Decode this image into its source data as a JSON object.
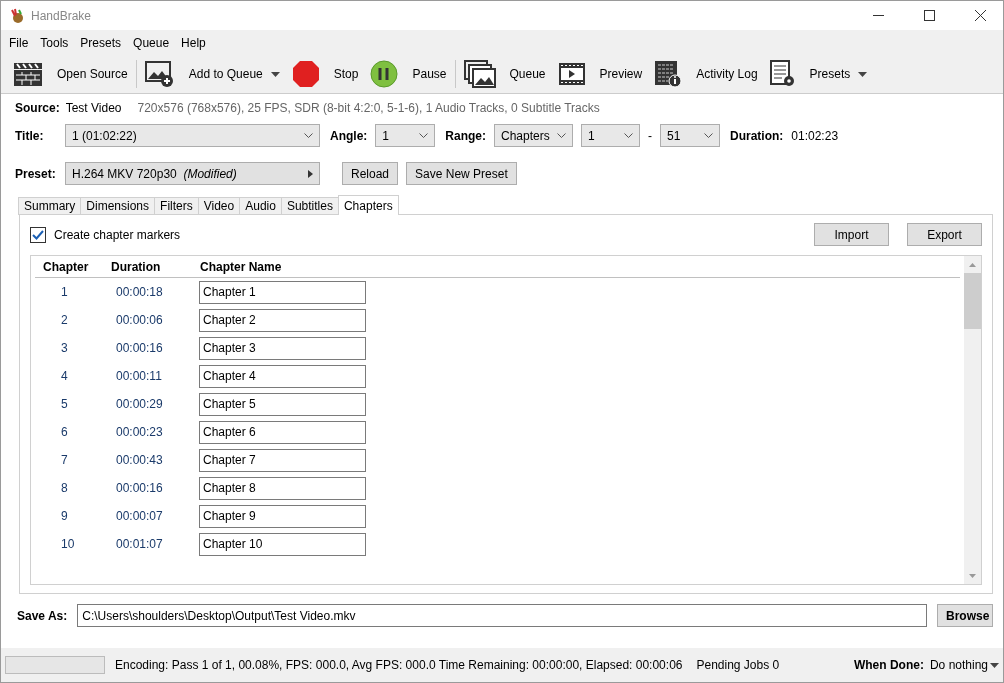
{
  "window": {
    "title": "HandBrake"
  },
  "menu": [
    "File",
    "Tools",
    "Presets",
    "Queue",
    "Help"
  ],
  "toolbar": [
    {
      "kind": "open",
      "label": "Open Source",
      "dropdown": false
    },
    {
      "kind": "add",
      "label": "Add to Queue",
      "dropdown": true
    },
    {
      "kind": "stop",
      "label": "Stop",
      "dropdown": false
    },
    {
      "kind": "pause",
      "label": "Pause",
      "dropdown": false
    },
    {
      "kind": "queue",
      "label": "Queue",
      "dropdown": false
    },
    {
      "kind": "preview",
      "label": "Preview",
      "dropdown": false
    },
    {
      "kind": "log",
      "label": "Activity Log",
      "dropdown": false
    },
    {
      "kind": "presets",
      "label": "Presets",
      "dropdown": true
    }
  ],
  "source": {
    "label": "Source:",
    "name": "Test Video",
    "info": "720x576 (768x576), 25 FPS, SDR (8-bit 4:2:0, 5-1-6), 1 Audio Tracks, 0 Subtitle Tracks"
  },
  "title_row": {
    "title_label": "Title:",
    "title_value": "1  (01:02:22)",
    "angle_label": "Angle:",
    "angle_value": "1",
    "range_label": "Range:",
    "range_mode": "Chapters",
    "range_start": "1",
    "range_dash": "-",
    "range_end": "51",
    "duration_label": "Duration:",
    "duration_value": "01:02:23"
  },
  "preset": {
    "label": "Preset:",
    "name": "H.264 MKV 720p30",
    "note": "(Modified)",
    "buttons": [
      "Reload",
      "Save New Preset"
    ]
  },
  "tabs": [
    {
      "label": "Summary",
      "selected": false
    },
    {
      "label": "Dimensions",
      "selected": false
    },
    {
      "label": "Filters",
      "selected": false
    },
    {
      "label": "Video",
      "selected": false
    },
    {
      "label": "Audio",
      "selected": false
    },
    {
      "label": "Subtitles",
      "selected": false
    },
    {
      "label": "Chapters",
      "selected": true
    }
  ],
  "chapters_panel": {
    "create_markers": {
      "label": "Create chapter markers",
      "checked": true
    },
    "buttons": [
      "Import",
      "Export"
    ],
    "columns": [
      "Chapter",
      "Duration",
      "Chapter Name"
    ],
    "rows": [
      {
        "chapter": "1",
        "duration": "00:00:18",
        "name": "Chapter 1"
      },
      {
        "chapter": "2",
        "duration": "00:00:06",
        "name": "Chapter 2"
      },
      {
        "chapter": "3",
        "duration": "00:00:16",
        "name": "Chapter 3"
      },
      {
        "chapter": "4",
        "duration": "00:00:11",
        "name": "Chapter 4"
      },
      {
        "chapter": "5",
        "duration": "00:00:29",
        "name": "Chapter 5"
      },
      {
        "chapter": "6",
        "duration": "00:00:23",
        "name": "Chapter 6"
      },
      {
        "chapter": "7",
        "duration": "00:00:43",
        "name": "Chapter 7"
      },
      {
        "chapter": "8",
        "duration": "00:00:16",
        "name": "Chapter 8"
      },
      {
        "chapter": "9",
        "duration": "00:00:07",
        "name": "Chapter 9"
      },
      {
        "chapter": "10",
        "duration": "00:01:07",
        "name": "Chapter 10"
      }
    ]
  },
  "save_as": {
    "label": "Save As:",
    "path": "C:\\Users\\shoulders\\Desktop\\Output\\Test Video.mkv",
    "button": "Browse"
  },
  "status_bar": {
    "progress": {
      "level": 0
    },
    "encoding": "Encoding: Pass 1 of 1,  00.08%, FPS: 000.0,  Avg FPS: 000.0 Time Remaining: 00:00:00,  Elapsed: 00:00:06",
    "pending": "Pending Jobs 0",
    "when_done_label": "When Done:",
    "when_done_value": "Do nothing"
  }
}
